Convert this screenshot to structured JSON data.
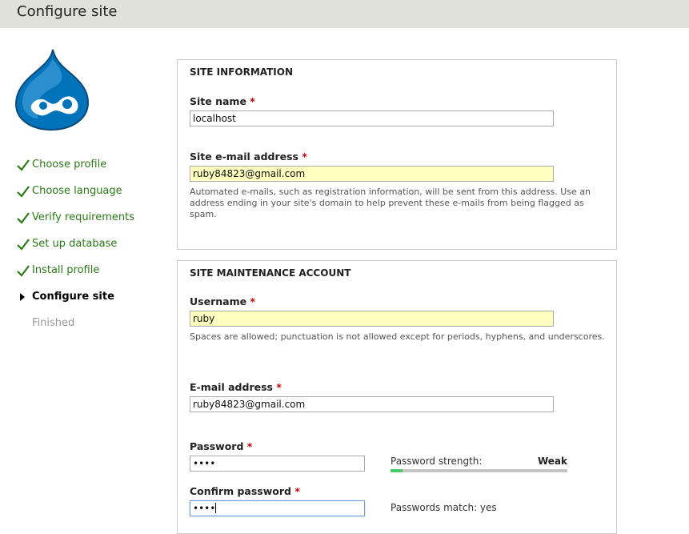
{
  "header": {
    "title": "Configure site"
  },
  "steps": [
    {
      "label": "Choose profile",
      "state": "done"
    },
    {
      "label": "Choose language",
      "state": "done"
    },
    {
      "label": "Verify requirements",
      "state": "done"
    },
    {
      "label": "Set up database",
      "state": "done"
    },
    {
      "label": "Install profile",
      "state": "done"
    },
    {
      "label": "Configure site",
      "state": "active"
    },
    {
      "label": "Finished",
      "state": "pending"
    }
  ],
  "site_info": {
    "legend": "SITE INFORMATION",
    "site_name_label": "Site name",
    "site_name_value": "localhost",
    "site_email_label": "Site e-mail address",
    "site_email_value": "ruby84823@gmail.com",
    "site_email_desc": "Automated e-mails, such as registration information, will be sent from this address. Use an address ending in your site's domain to help prevent these e-mails from being flagged as spam."
  },
  "account": {
    "legend": "SITE MAINTENANCE ACCOUNT",
    "username_label": "Username",
    "username_value": "ruby",
    "username_desc": "Spaces are allowed; punctuation is not allowed except for periods, hyphens, and underscores.",
    "email_label": "E-mail address",
    "email_value": "ruby84823@gmail.com",
    "password_label": "Password",
    "password_value": "••••",
    "strength_label": "Password strength:",
    "strength_value": "Weak",
    "strength_fraction": 0.07,
    "confirm_label": "Confirm password",
    "confirm_value": "••••",
    "match_text": "Passwords match: yes"
  },
  "required_mark": "*",
  "colors": {
    "header_bg": "#e1e1dc",
    "done_step": "#2a7a14",
    "required": "#cc0000",
    "filled_input": "#ffffc0",
    "strength_fill": "#47c965",
    "drupal_blue": "#0073ba"
  }
}
